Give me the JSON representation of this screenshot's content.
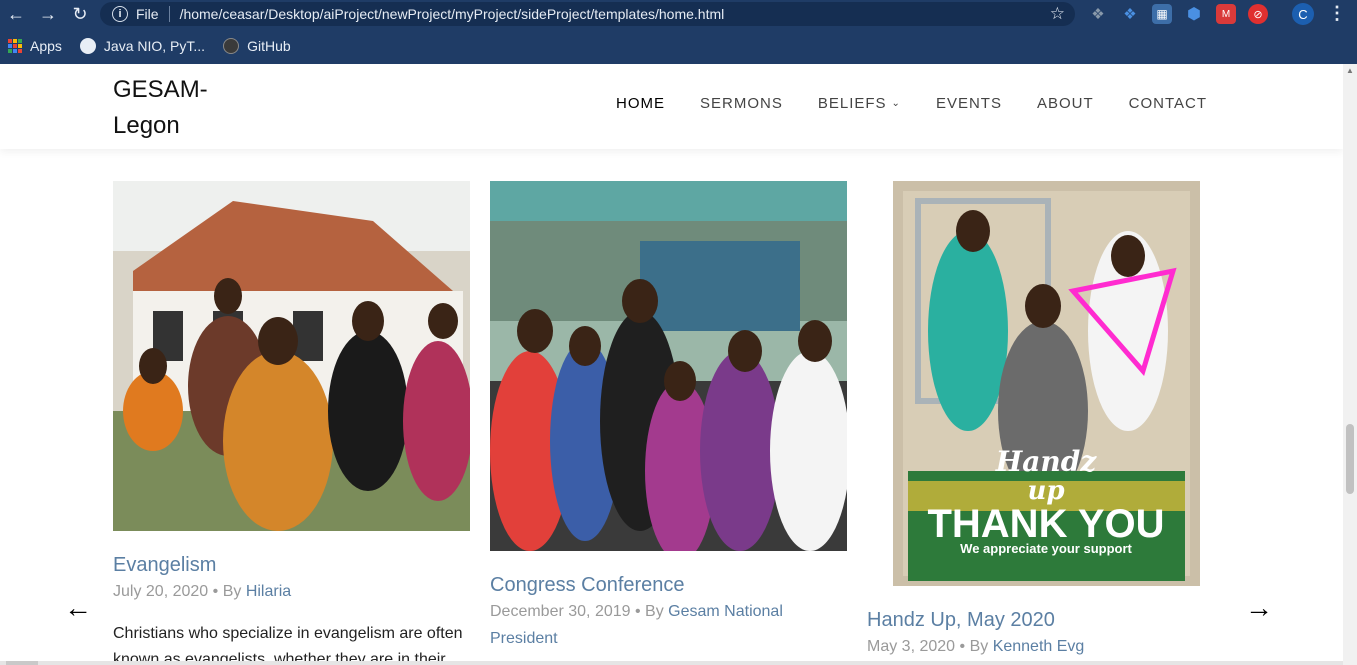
{
  "browser": {
    "address_scheme": "File",
    "address_url": "/home/ceasar/Desktop/aiProject/newProject/myProject/sideProject/templates/home.html",
    "profile_initial": "C",
    "bookmarks": [
      {
        "label": "Apps",
        "icon": "apps-grid-icon"
      },
      {
        "label": "Java NIO, PyT...",
        "icon": "globe-icon"
      },
      {
        "label": "GitHub",
        "icon": "github-icon"
      }
    ]
  },
  "site": {
    "brand_line1": "GESAM-",
    "brand_line2": "Legon",
    "nav": [
      {
        "label": "HOME",
        "active": true
      },
      {
        "label": "SERMONS"
      },
      {
        "label": "BELIEFS",
        "has_dropdown": true
      },
      {
        "label": "EVENTS"
      },
      {
        "label": "ABOUT"
      },
      {
        "label": "CONTACT"
      }
    ]
  },
  "cards": [
    {
      "title": "Evangelism",
      "date": "July 20, 2020",
      "by": "• By",
      "author": "Hilaria",
      "excerpt": "Christians who specialize in evangelism are often known as evangelists, whether they are in their",
      "image": "group-photo-evangelism"
    },
    {
      "title": "Congress Conference",
      "date": "December 30, 2019",
      "by": "• By",
      "author": "Gesam National President",
      "image": "group-photo-congress"
    },
    {
      "title": "Handz Up, May 2020",
      "date": "May 3, 2020",
      "by": "• By",
      "author": "Kenneth Evg",
      "image": "handz-up-poster",
      "poster_line1": "Handz",
      "poster_line2": "up",
      "poster_line3": "THANK YOU",
      "poster_line4": "We appreciate your support"
    }
  ],
  "colors": {
    "chrome": "#1f3c66",
    "link": "#5b7fa3",
    "meta": "#9a9a9a"
  }
}
